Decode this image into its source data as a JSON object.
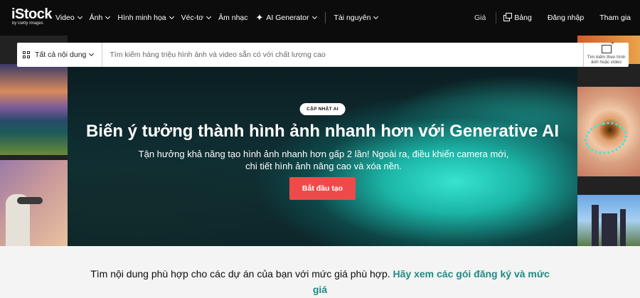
{
  "brand": {
    "name": "iStock",
    "tagline": "by Getty Images"
  },
  "nav": {
    "items": [
      {
        "label": "Video",
        "dropdown": true
      },
      {
        "label": "Ảnh",
        "dropdown": true
      },
      {
        "label": "Hình minh họa",
        "dropdown": true
      },
      {
        "label": "Véc-tơ",
        "dropdown": true
      },
      {
        "label": "Âm nhạc",
        "dropdown": false
      },
      {
        "label": "AI Generator",
        "dropdown": true,
        "icon": "sparkle-icon"
      },
      {
        "label": "Tài nguyên",
        "dropdown": true
      }
    ],
    "right": {
      "price": "Giá",
      "board": "Bảng",
      "login": "Đăng nhập",
      "join": "Tham gia"
    }
  },
  "search": {
    "filter_label": "Tất cả nội dung",
    "placeholder": "Tìm kiếm hàng triệu hình ảnh và video sẵn có với chất lượng cao",
    "visual_search_label": "Tìm kiếm theo hình ảnh hoặc video"
  },
  "hero": {
    "badge": "CẬP NHẬT AI",
    "title": "Biến ý tưởng thành hình ảnh nhanh hơn với Generative AI",
    "subtitle": "Tận hưởng khả năng tạo hình ảnh nhanh hơn gấp 2 lần! Ngoài ra, điều khiển camera mới, chi tiết hình ảnh nâng cao và xóa nền.",
    "cta": "Bắt đầu tạo"
  },
  "promo": {
    "text": "Tìm nội dung phù hợp cho các dự án của bạn với mức giá phù hợp.",
    "link": "Hãy xem các gói đăng ký và mức giá"
  },
  "colors": {
    "cta": "#ef4a4a",
    "link": "#1f8a80",
    "nav_bg": "#0c0c0c",
    "hero_glow": "#37e3d0"
  }
}
